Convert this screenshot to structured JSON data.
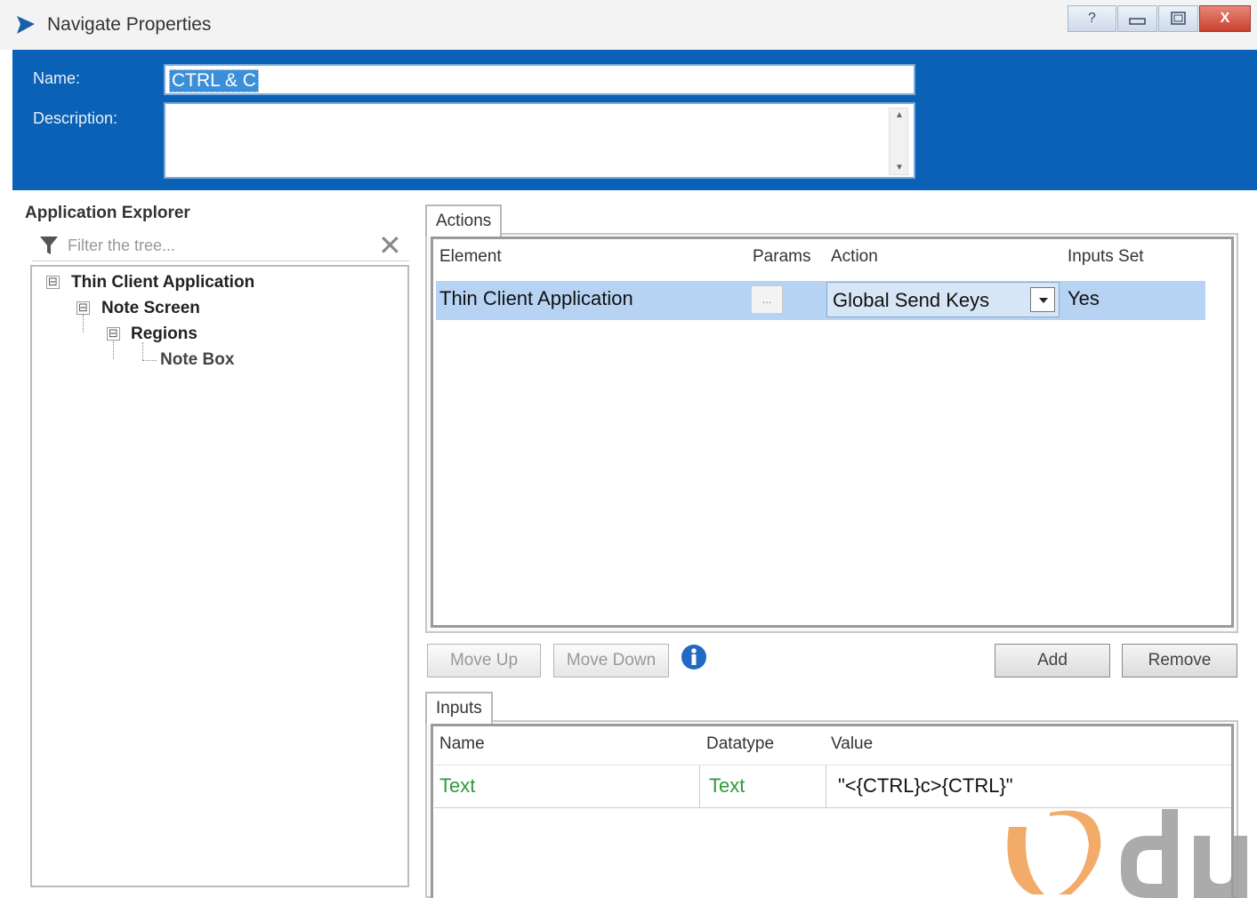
{
  "window": {
    "title": "Navigate Properties",
    "buttons": {
      "help": "?",
      "close": "X"
    }
  },
  "header": {
    "name_label": "Name:",
    "name_value": "CTRL & C",
    "description_label": "Description:",
    "description_value": ""
  },
  "explorer": {
    "title": "Application Explorer",
    "filter_placeholder": "Filter the tree...",
    "tree": [
      {
        "label": "Thin Client Application",
        "toggle": "⊟"
      },
      {
        "label": "Note Screen",
        "toggle": "⊟"
      },
      {
        "label": "Regions",
        "toggle": "⊟"
      },
      {
        "label": "Note Box"
      }
    ]
  },
  "actions": {
    "tab_label": "Actions",
    "columns": [
      "Element",
      "Params",
      "Action",
      "Inputs Set"
    ],
    "rows": [
      {
        "element": "Thin Client Application",
        "params": "...",
        "action": "Global Send Keys",
        "inputs_set": "Yes"
      }
    ]
  },
  "buttons": {
    "move_up": "Move Up",
    "move_down": "Move Down",
    "add": "Add",
    "remove": "Remove"
  },
  "inputs": {
    "tab_label": "Inputs",
    "columns": [
      "Name",
      "Datatype",
      "Value"
    ],
    "rows": [
      {
        "name": "Text",
        "datatype": "Text",
        "value": "\"<{CTRL}c>{CTRL}\""
      }
    ]
  },
  "colors": {
    "header_blue": "#0a61b6",
    "selection_blue": "#b7d3f3",
    "input_green": "#2e9a3a",
    "watermark_orange": "#f2a25a"
  }
}
